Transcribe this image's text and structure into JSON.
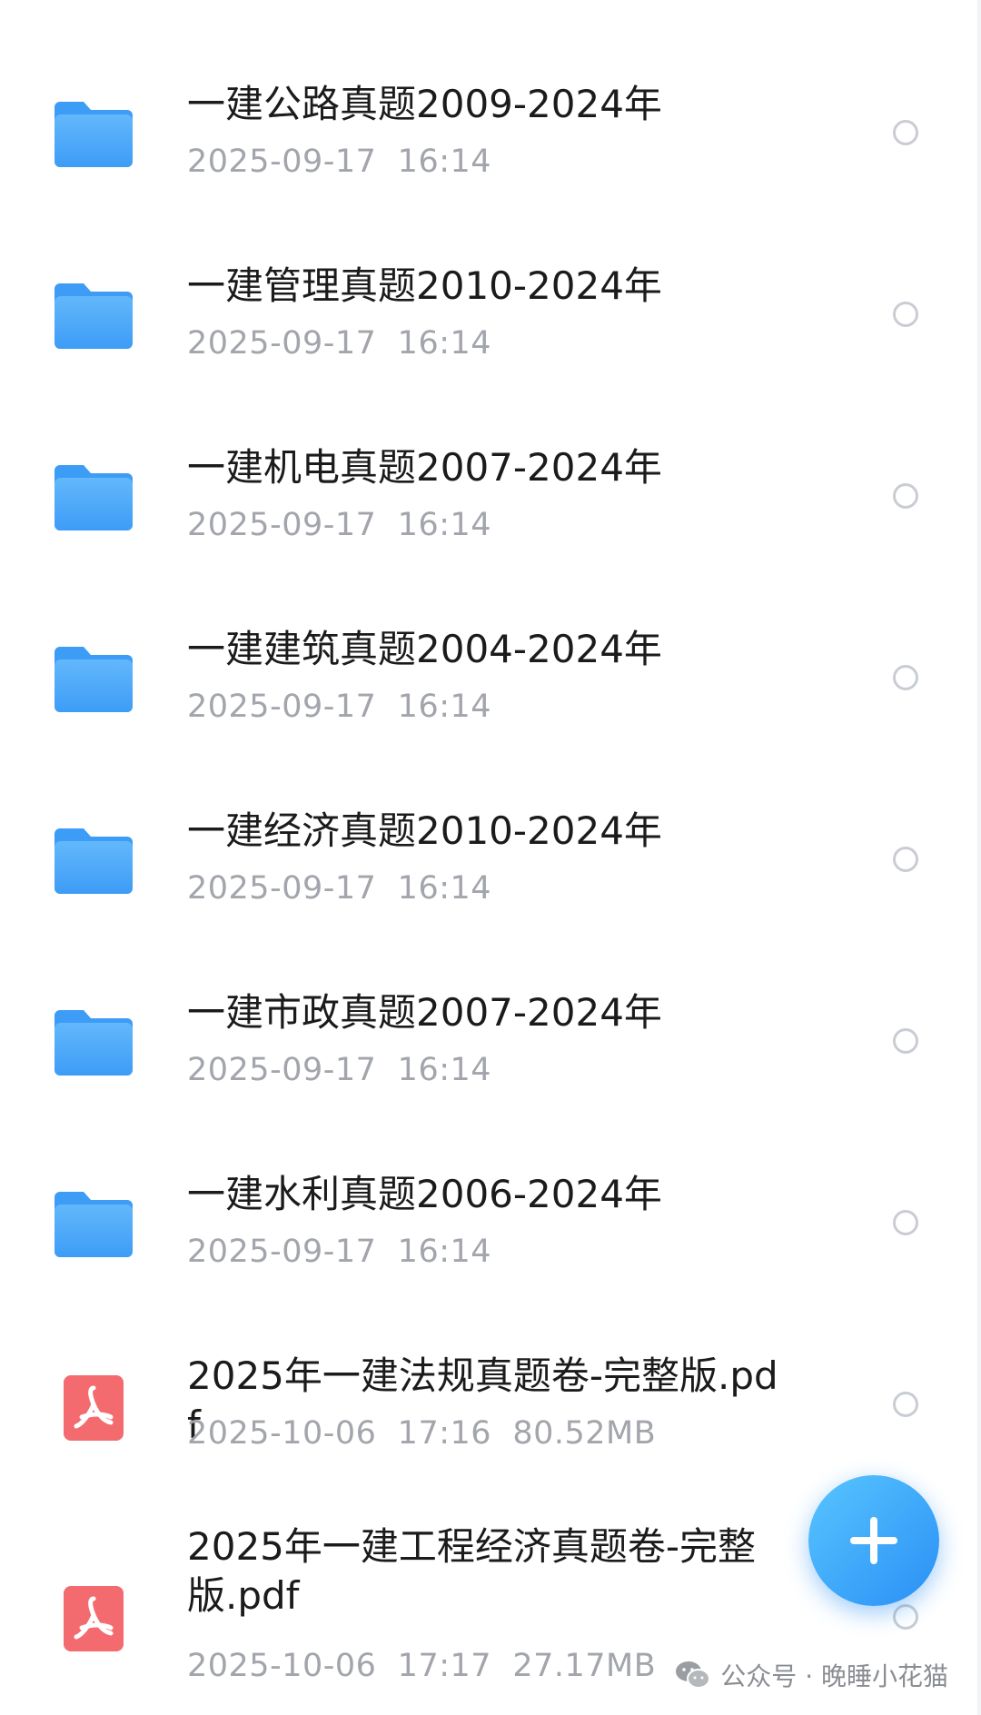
{
  "files": [
    {
      "type": "folder",
      "icon": "folder-icon",
      "name": "一建公路真题2009-2024年",
      "date": "2025-09-17",
      "time": "16:14",
      "size": ""
    },
    {
      "type": "folder",
      "icon": "folder-icon",
      "name": "一建管理真题2010-2024年",
      "date": "2025-09-17",
      "time": "16:14",
      "size": ""
    },
    {
      "type": "folder",
      "icon": "folder-icon",
      "name": "一建机电真题2007-2024年",
      "date": "2025-09-17",
      "time": "16:14",
      "size": ""
    },
    {
      "type": "folder",
      "icon": "folder-icon",
      "name": "一建建筑真题2004-2024年",
      "date": "2025-09-17",
      "time": "16:14",
      "size": ""
    },
    {
      "type": "folder",
      "icon": "folder-icon",
      "name": "一建经济真题2010-2024年",
      "date": "2025-09-17",
      "time": "16:14",
      "size": ""
    },
    {
      "type": "folder",
      "icon": "folder-icon",
      "name": "一建市政真题2007-2024年",
      "date": "2025-09-17",
      "time": "16:14",
      "size": ""
    },
    {
      "type": "folder",
      "icon": "folder-icon",
      "name": "一建水利真题2006-2024年",
      "date": "2025-09-17",
      "time": "16:14",
      "size": ""
    },
    {
      "type": "pdf",
      "icon": "pdf-icon",
      "name": "2025年一建法规真题卷-完整版.pdf",
      "date": "2025-10-06",
      "time": "17:16",
      "size": "80.52MB"
    },
    {
      "type": "pdf",
      "icon": "pdf-icon",
      "name": "2025年一建工程经济真题卷-完整版.pdf",
      "date": "2025-10-06",
      "time": "17:17",
      "size": "27.17MB"
    }
  ],
  "fab": {
    "icon": "plus-icon"
  },
  "watermark": {
    "icon": "wechat-icon",
    "text": "公众号 · 晚睡小花猫"
  },
  "colors": {
    "folder": "#4aa8f8",
    "pdf": "#f46b6f",
    "accent": "#2a8ff5",
    "meta_text": "#a2a5ab"
  }
}
